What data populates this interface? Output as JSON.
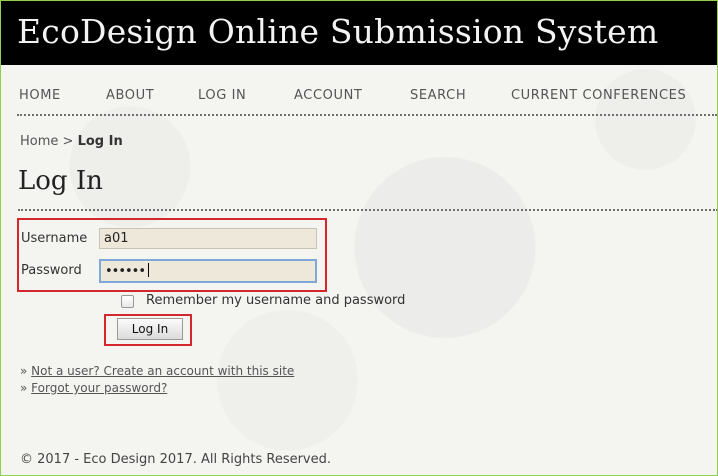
{
  "site": {
    "title": "EcoDesign Online Submission System"
  },
  "nav": {
    "items": [
      {
        "label": "HOME"
      },
      {
        "label": "ABOUT"
      },
      {
        "label": "LOG IN"
      },
      {
        "label": "ACCOUNT"
      },
      {
        "label": "SEARCH"
      },
      {
        "label": "CURRENT CONFERENCES"
      }
    ]
  },
  "breadcrumb": {
    "home": "Home",
    "separator": ">",
    "current": "Log In"
  },
  "page": {
    "title": "Log In"
  },
  "login_form": {
    "username_label": "Username",
    "username_value": "a01",
    "password_label": "Password",
    "password_value": "••••••",
    "remember_label": "Remember my username and password",
    "remember_checked": false,
    "submit_label": "Log In"
  },
  "links": {
    "prefix": "»",
    "create_account": "Not a user? Create an account with this site",
    "forgot_password": "Forgot your password?"
  },
  "footer": {
    "text": "© 2017 - Eco Design 2017. All Rights Reserved."
  },
  "colors": {
    "header_bg": "#000000",
    "highlight": "#d3262d",
    "focus_border": "#7fa8d9"
  }
}
